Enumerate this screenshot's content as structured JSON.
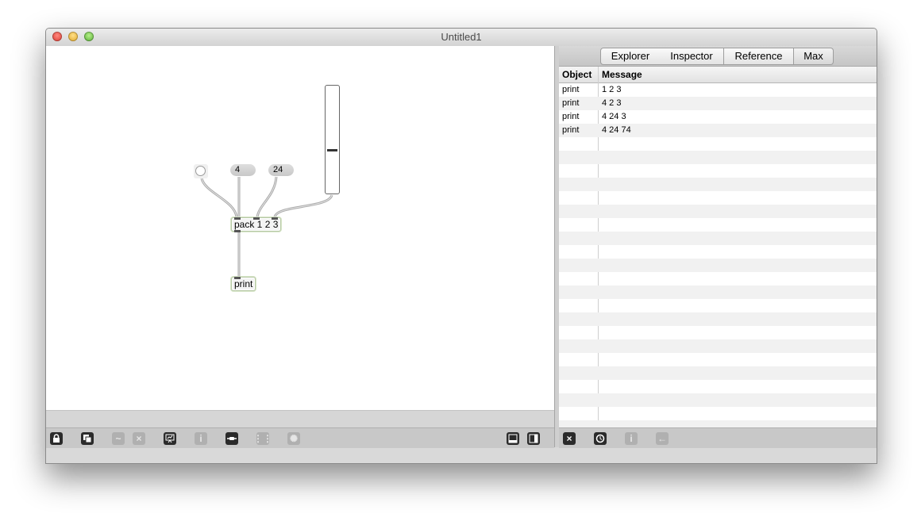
{
  "window": {
    "title": "Untitled1"
  },
  "patcher": {
    "number_a": "4",
    "number_b": "24",
    "pack_object": "pack 1 2 3",
    "print_object": "print",
    "slider_value_fraction": 0.41
  },
  "sidebar": {
    "tabs": [
      {
        "label": "Explorer"
      },
      {
        "label": "Inspector"
      },
      {
        "label": "Reference"
      },
      {
        "label": "Max"
      }
    ],
    "active_tab": "Max",
    "columns": {
      "object": "Object",
      "message": "Message"
    },
    "rows": [
      {
        "object": "print",
        "message": "1 2 3"
      },
      {
        "object": "print",
        "message": "4 2 3"
      },
      {
        "object": "print",
        "message": "4 24 3"
      },
      {
        "object": "print",
        "message": "4 24 74"
      }
    ]
  },
  "toolbar": {
    "left_icons": [
      "lock-icon",
      "presentation-toggle-icon",
      "patch-cords-icon",
      "delete-icon",
      "debug-icon",
      "info-icon",
      "object-icon",
      "grid-icon",
      "extras-icon"
    ],
    "right_icons": [
      "bottom-panel-icon",
      "side-panel-icon"
    ],
    "sidebar_icons": [
      "clear-icon",
      "timestamp-icon",
      "info-icon",
      "back-icon"
    ]
  },
  "colors": {
    "accent": "#b7c9a6",
    "window_bg": "#d9d9d9"
  }
}
